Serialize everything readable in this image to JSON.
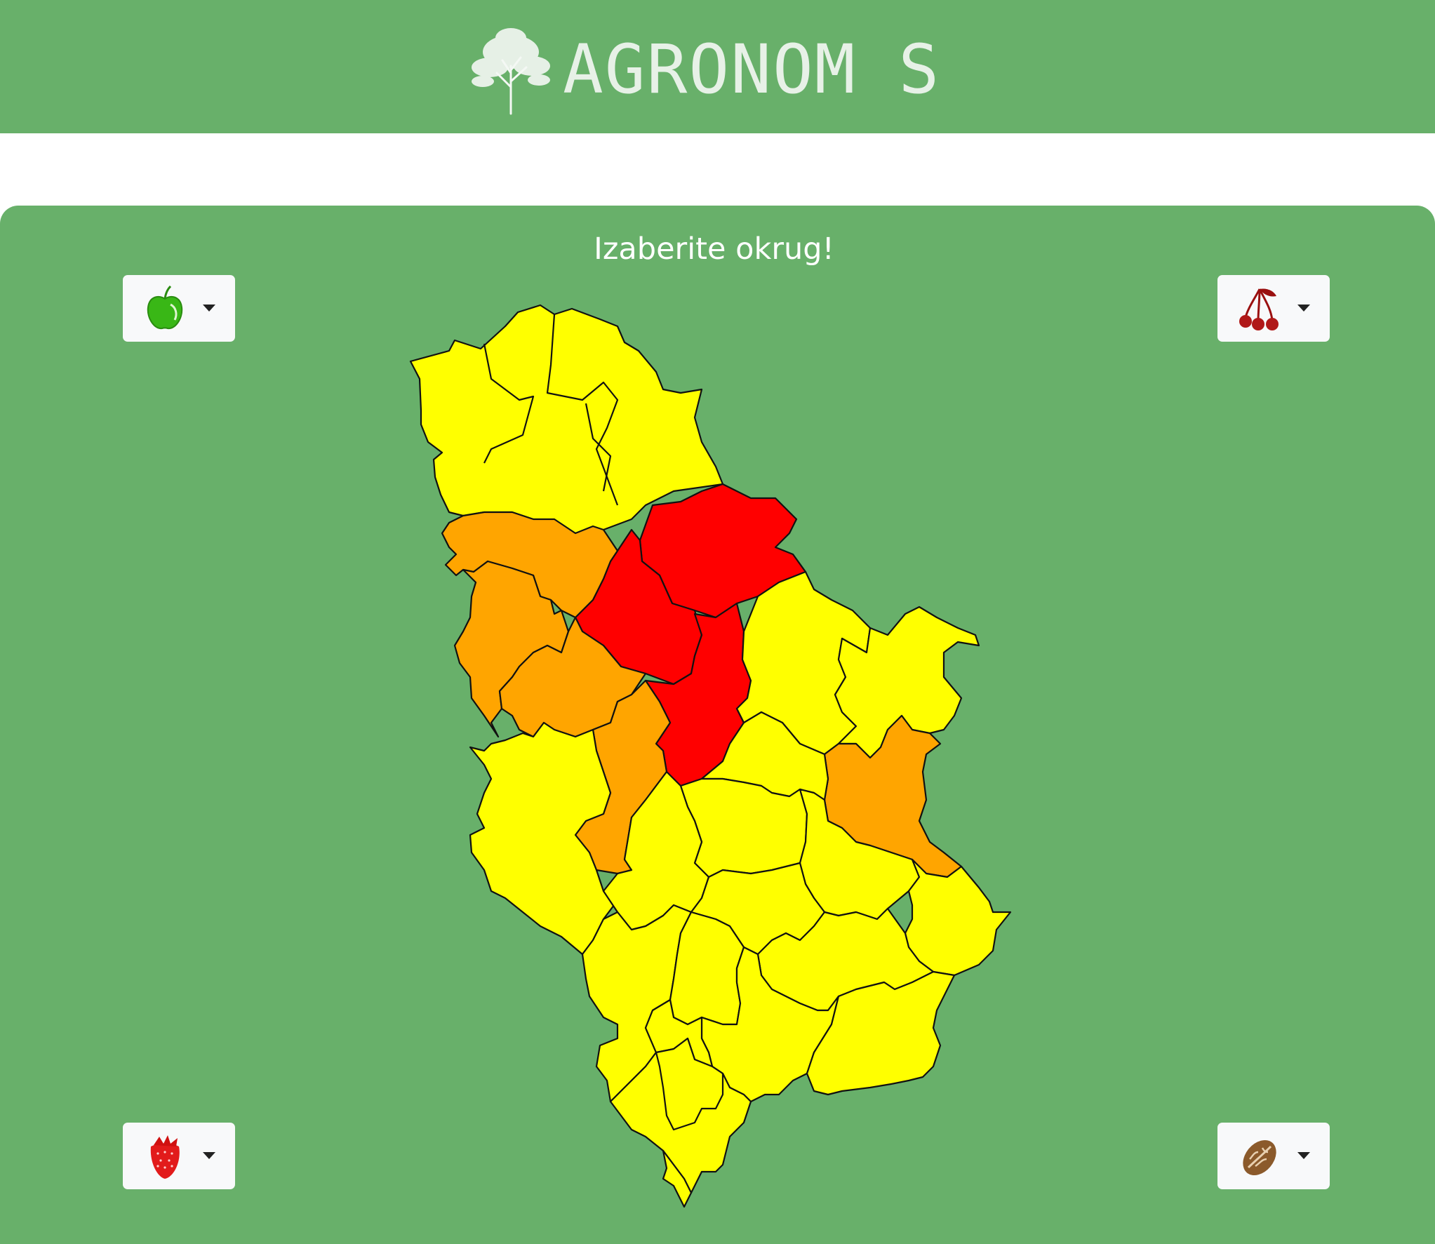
{
  "header": {
    "brand_title": "AGRONOM S"
  },
  "panel": {
    "title": "Izaberite okrug!"
  },
  "dropdowns": {
    "top_left": {
      "icon": "green-apple-icon"
    },
    "top_right": {
      "icon": "cherries-icon"
    },
    "bottom_left": {
      "icon": "strawberry-icon"
    },
    "bottom_right": {
      "icon": "walnut-icon"
    }
  },
  "map": {
    "colors": {
      "background": "#68b06a",
      "low": "#ffff00",
      "medium": "#ffa500",
      "high": "#ff0000"
    }
  }
}
